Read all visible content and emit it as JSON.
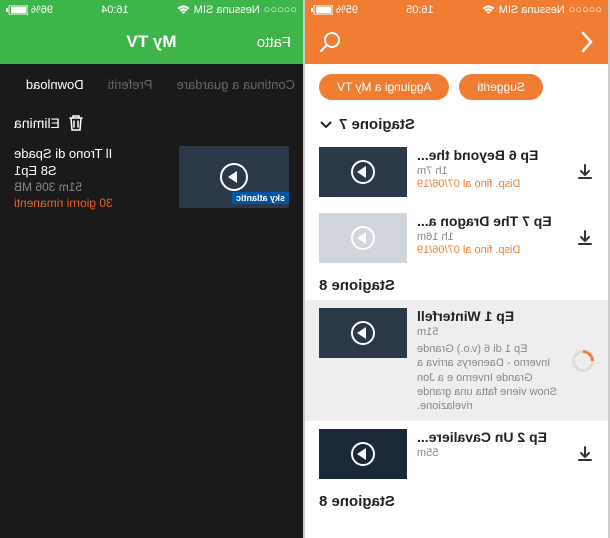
{
  "left": {
    "status": {
      "carrier": "Nessuna SIM",
      "time": "16:04",
      "battery": "96%"
    },
    "header": {
      "title": "My TV",
      "done": "Fatto"
    },
    "tabs": {
      "t1": "Continua a guardare",
      "t2": "Preferiti",
      "t3": "Download"
    },
    "delete": "Elimina",
    "download": {
      "title": "Il Trono di Spade",
      "subtitle": "S8 Ep1",
      "size": "51m 306 MB",
      "remaining": "30 giorni rimanenti",
      "channel": "sky atlantic"
    }
  },
  "right": {
    "status": {
      "carrier": "Nessuna SIM",
      "time": "16:05",
      "battery": "95%"
    },
    "pills": {
      "p1": "Suggeriti",
      "p2": "Aggiungi a My TV"
    },
    "season7": "Stagione 7",
    "season8": "Stagione 8",
    "season8b": "Stagione 8",
    "ep6": {
      "title": "Ep 6 Beyond the...",
      "sub": "1h 7m",
      "avail": "Disp. fino al 07/06/19"
    },
    "ep7": {
      "title": "Ep 7 The Dragon a...",
      "sub": "1h 16m",
      "avail": "Disp. fino al 07/06/19"
    },
    "ep1": {
      "title": "Ep 1 Winterfell",
      "sub": "51m",
      "desc": "Ep 1 di 6 (v.o.) Grande Inverno - Daenerys arriva a Grande Inverno e a Jon Snow viene fatta una grande rivelazione."
    },
    "ep2": {
      "title": "Ep 2 Un Cavaliere...",
      "sub": "55m"
    }
  }
}
